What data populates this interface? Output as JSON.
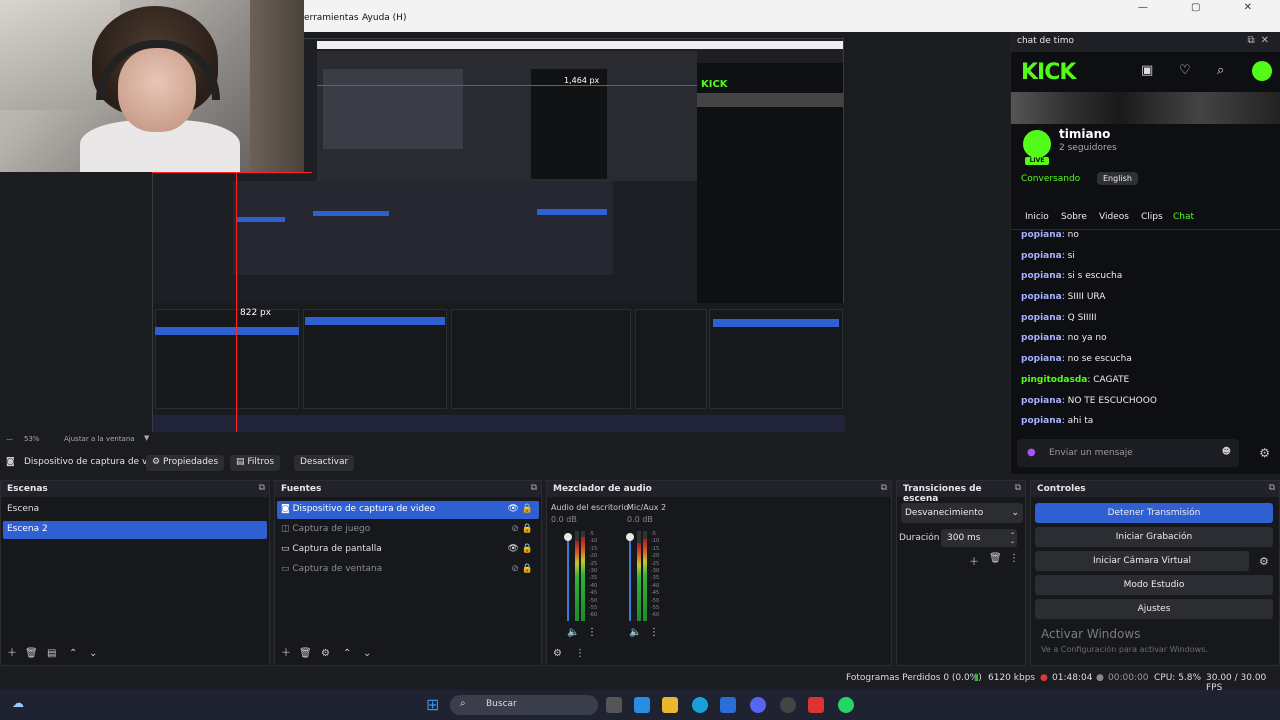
{
  "menubar": {
    "menu1": "erramientas",
    "menu2": "Ayuda (H)",
    "window_controls": "— ▢ ✕"
  },
  "preview": {
    "size_label": "822 px",
    "size_label2": "1,464 px"
  },
  "zoom": {
    "percent": "53%",
    "fit": "Ajustar a la ventana"
  },
  "source_toolbar": {
    "device": "Dispositivo de captura de v",
    "properties": "Propiedades",
    "filters": "Filtros",
    "deactivate": "Desactivar"
  },
  "chat": {
    "panel_title": "chat de timo",
    "logo": "KICK",
    "username": "timiano",
    "followers": "2 seguidores",
    "status": "Conversando",
    "language": "English",
    "live_badge": "LIVE",
    "tabs": [
      "Inicio",
      "Sobre",
      "Videos",
      "Clips",
      "Chat"
    ],
    "messages": [
      {
        "user": "popiana",
        "text": "no"
      },
      {
        "user": "popiana",
        "text": "si"
      },
      {
        "user": "popiana",
        "text": "si s escucha"
      },
      {
        "user": "popiana",
        "text": "SIIII URA"
      },
      {
        "user": "popiana",
        "text": "Q SIIIII"
      },
      {
        "user": "popiana",
        "text": "no ya no"
      },
      {
        "user": "popiana",
        "text": "no se escucha"
      },
      {
        "user": "pingitodasda",
        "text": "CAGATE"
      },
      {
        "user": "popiana",
        "text": "NO TE ESCUCHOOO"
      },
      {
        "user": "popiana",
        "text": "ahi ta"
      }
    ],
    "input_placeholder": "Enviar un mensaje"
  },
  "scenes": {
    "title": "Escenas",
    "items": [
      "Escena",
      "Escena 2"
    ]
  },
  "sources": {
    "title": "Fuentes",
    "items": [
      "Dispositivo de captura de video",
      "Captura de juego",
      "Captura de pantalla",
      "Captura de ventana"
    ]
  },
  "mixer": {
    "title": "Mezclador de audio",
    "channels": [
      {
        "name": "Audio del escritorio",
        "db": "0.0 dB"
      },
      {
        "name": "Mic/Aux 2",
        "db": "0.0 dB"
      }
    ],
    "scale": [
      "-5",
      "-10",
      "-15",
      "-20",
      "-25",
      "-30",
      "-35",
      "-40",
      "-45",
      "-50",
      "-55",
      "-60"
    ]
  },
  "transitions": {
    "title": "Transiciones de escena",
    "selected": "Desvanecimiento",
    "duration_label": "Duración",
    "duration_value": "300 ms"
  },
  "controls": {
    "title": "Controles",
    "buttons": [
      "Detener Transmisión",
      "Iniciar Grabación",
      "Iniciar Cámara Virtual",
      "Modo Estudio",
      "Ajustes"
    ],
    "activate_title": "Activar Windows",
    "activate_sub": "Ve a Configuración para activar Windows."
  },
  "status": {
    "dropped": "Fotogramas Perdidos 0 (0.0%)",
    "bitrate": "6120 kbps",
    "stream_time": "01:48:04",
    "rec_time": "00:00:00",
    "cpu": "CPU: 5.8%",
    "fps": "30.00 / 30.00 FPS"
  },
  "taskbar": {
    "search": "Buscar"
  },
  "colors": {
    "accent_blue": "#2f5fd0",
    "kick_green": "#53fc18",
    "live_red": "#d83b3b"
  }
}
